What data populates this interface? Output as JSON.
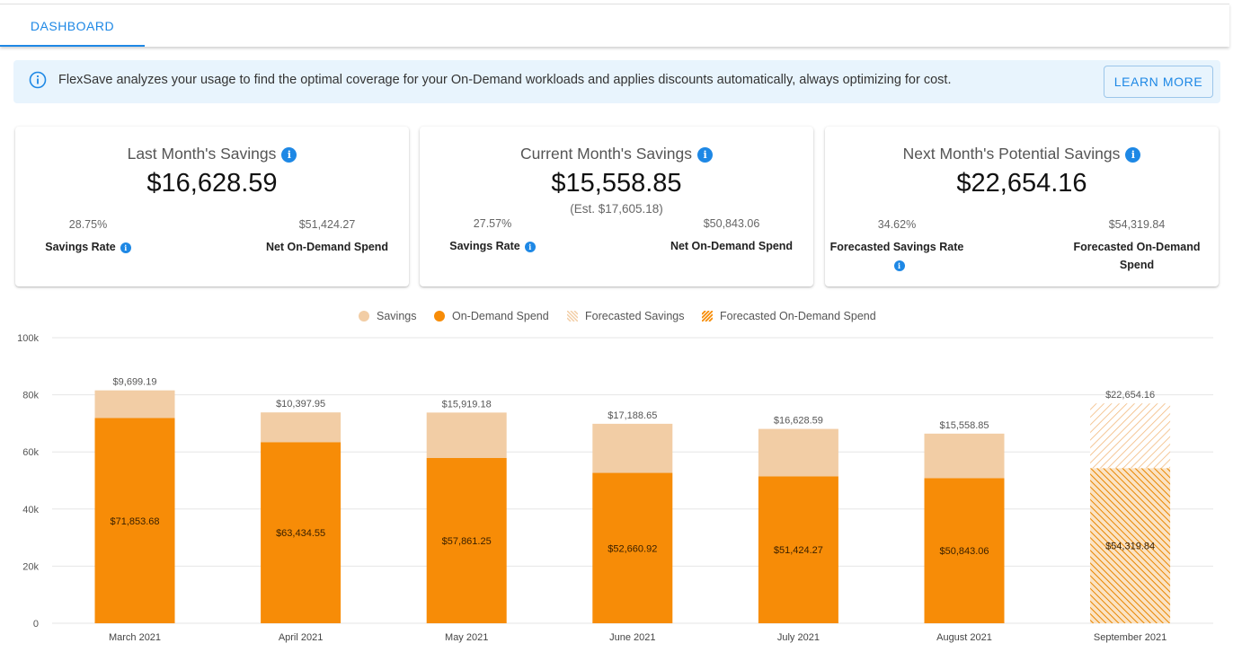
{
  "tabs": [
    {
      "label": "DASHBOARD",
      "active": true
    }
  ],
  "banner": {
    "icon": "info-icon",
    "text": "FlexSave analyzes your usage to find the optimal coverage for your On-Demand workloads and applies discounts automatically, always optimizing for cost.",
    "button_label": "LEARN MORE"
  },
  "cards": [
    {
      "title": "Last Month's Savings",
      "value": "$16,628.59",
      "est": "",
      "left_stat": {
        "value": "28.75%",
        "label": "Savings Rate"
      },
      "right_stat": {
        "value": "$51,424.27",
        "label": "Net On-Demand Spend"
      }
    },
    {
      "title": "Current Month's Savings",
      "value": "$15,558.85",
      "est": "(Est. $17,605.18)",
      "left_stat": {
        "value": "27.57%",
        "label": "Savings Rate"
      },
      "right_stat": {
        "value": "$50,843.06",
        "label": "Net On-Demand Spend"
      }
    },
    {
      "title": "Next Month's Potential Savings",
      "value": "$22,654.16",
      "est": "",
      "left_stat": {
        "value": "34.62%",
        "label": "Forecasted Savings Rate"
      },
      "right_stat": {
        "value": "$54,319.84",
        "label": "Forecasted On-Demand Spend"
      }
    }
  ],
  "colors": {
    "accent": "#1e88e5",
    "savings": "#f2cda5",
    "on_demand": "#f78c07",
    "banner_bg": "#e8f4fd"
  },
  "chart_data": {
    "type": "bar",
    "stacked": true,
    "legend_position": "top",
    "grid": true,
    "categories": [
      "March 2021",
      "April 2021",
      "May 2021",
      "June 2021",
      "July 2021",
      "August 2021",
      "September 2021"
    ],
    "series": [
      {
        "name": "On-Demand Spend",
        "values": [
          71853.68,
          63434.55,
          57861.25,
          52660.92,
          51424.27,
          50843.06,
          null
        ],
        "labels": [
          "$71,853.68",
          "$63,434.55",
          "$57,861.25",
          "$52,660.92",
          "$51,424.27",
          "$50,843.06",
          ""
        ]
      },
      {
        "name": "Savings",
        "values": [
          9699.19,
          10397.95,
          15919.18,
          17188.65,
          16628.59,
          15558.85,
          null
        ],
        "labels": [
          "$9,699.19",
          "$10,397.95",
          "$15,919.18",
          "$17,188.65",
          "$16,628.59",
          "$15,558.85",
          ""
        ]
      },
      {
        "name": "Forecasted On-Demand Spend",
        "values": [
          null,
          null,
          null,
          null,
          null,
          null,
          54319.84
        ],
        "labels": [
          "",
          "",
          "",
          "",
          "",
          "",
          "$54,319.84"
        ]
      },
      {
        "name": "Forecasted Savings",
        "values": [
          null,
          null,
          null,
          null,
          null,
          null,
          22654.16
        ],
        "labels": [
          "",
          "",
          "",
          "",
          "",
          "",
          "$22,654.16"
        ]
      }
    ],
    "yticks": [
      "0",
      "20k",
      "40k",
      "60k",
      "80k",
      "100k"
    ],
    "ylim": [
      0,
      100000
    ]
  }
}
